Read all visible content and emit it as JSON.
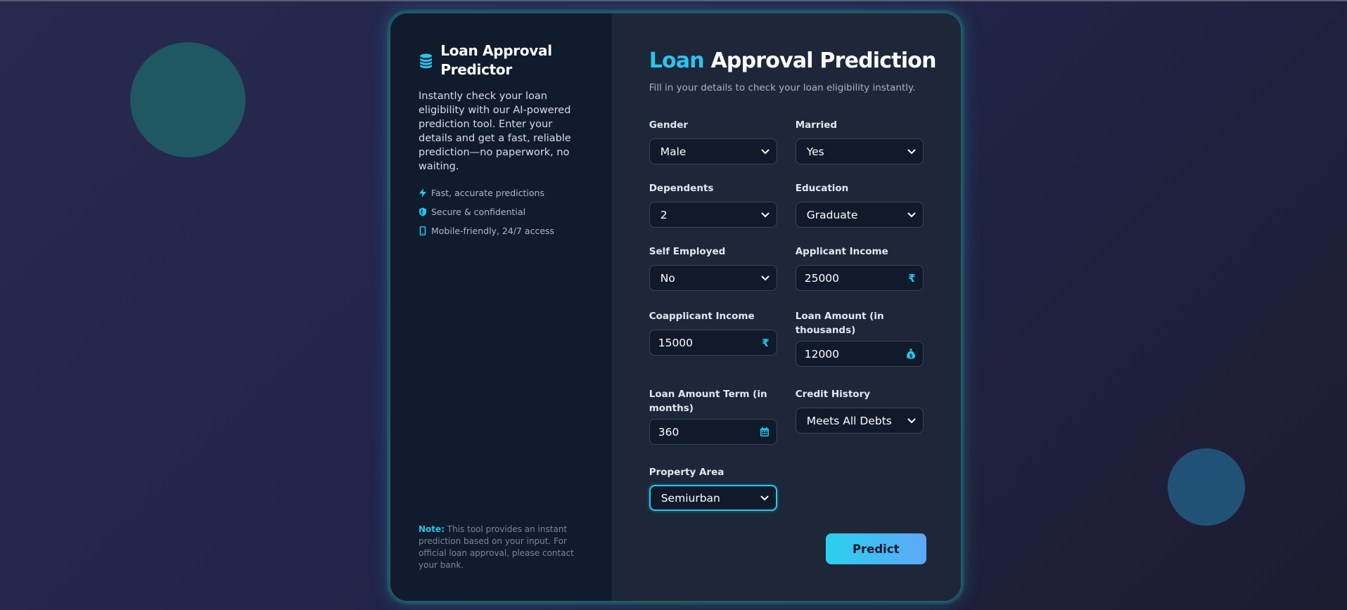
{
  "brand": {
    "title": "Loan Approval Predictor",
    "description": "Instantly check your loan eligibility with our AI-powered prediction tool. Enter your details and get a fast, reliable prediction—no paperwork, no waiting.",
    "features": [
      {
        "icon": "bolt-icon",
        "text": "Fast, accurate predictions"
      },
      {
        "icon": "shield-icon",
        "text": "Secure & confidential"
      },
      {
        "icon": "mobile-icon",
        "text": "Mobile-friendly, 24/7 access"
      }
    ],
    "note_label": "Note:",
    "note_text": " This tool provides an instant prediction based on your input. For official loan approval, please contact your bank."
  },
  "form": {
    "heading_accent": "Loan",
    "heading_rest": " Approval Prediction",
    "subheading": "Fill in your details to check your loan eligibility instantly.",
    "fields": {
      "gender": {
        "label": "Gender",
        "value": "Male"
      },
      "married": {
        "label": "Married",
        "value": "Yes"
      },
      "dependents": {
        "label": "Dependents",
        "value": "2"
      },
      "education": {
        "label": "Education",
        "value": "Graduate"
      },
      "self_employed": {
        "label": "Self Employed",
        "value": "No"
      },
      "applicant_income": {
        "label": "Applicant Income",
        "value": "25000",
        "icon": "rupee-icon",
        "symbol": "₹"
      },
      "coapplicant_income": {
        "label": "Coapplicant Income",
        "value": "15000",
        "icon": "rupee-icon",
        "symbol": "₹"
      },
      "loan_amount": {
        "label": "Loan Amount (in thousands)",
        "value": "12000",
        "icon": "money-bag-icon"
      },
      "loan_term": {
        "label": "Loan Amount Term (in months)",
        "value": "360",
        "icon": "calendar-icon"
      },
      "credit_history": {
        "label": "Credit History",
        "value": "Meets All Debts"
      },
      "property_area": {
        "label": "Property Area",
        "value": "Semiurban"
      }
    },
    "predict_label": "Predict"
  },
  "colors": {
    "accent": "#29c6ec",
    "left_panel": "#111b2e",
    "right_panel": "#1d2739",
    "button_gradient_start": "#2ad0ee",
    "button_gradient_end": "#5ea7f8"
  }
}
